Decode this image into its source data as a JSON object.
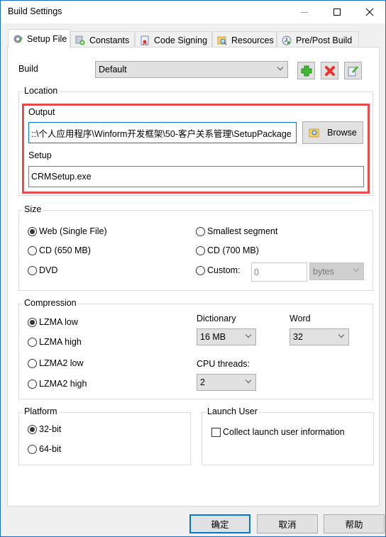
{
  "window": {
    "title": "Build Settings",
    "controls": [
      "minimize",
      "maximize",
      "close"
    ]
  },
  "tabs": [
    {
      "label": "Setup File",
      "icon": "gear-pencil-icon",
      "active": true
    },
    {
      "label": "Constants",
      "icon": "constants-add-icon",
      "active": false
    },
    {
      "label": "Code Signing",
      "icon": "certificate-icon",
      "active": false
    },
    {
      "label": "Resources",
      "icon": "resources-search-icon",
      "active": false
    },
    {
      "label": "Pre/Post Build",
      "icon": "clock-play-icon",
      "active": false
    }
  ],
  "build": {
    "label": "Build",
    "selected": "Default",
    "buttons": [
      {
        "name": "add",
        "icon": "plus-icon",
        "color": "#3fb832"
      },
      {
        "name": "delete",
        "icon": "x-icon",
        "color": "#e8322a"
      },
      {
        "name": "edit",
        "icon": "edit-icon",
        "color": "#3fb832"
      }
    ]
  },
  "location": {
    "title": "Location",
    "output_label": "Output",
    "output_value": "::\\个人应用程序\\Winform开发框架\\50-客户关系管理\\SetupPackage",
    "browse_label": "Browse",
    "setup_label": "Setup",
    "setup_value": "CRMSetup.exe",
    "highlight_color": "#e94b4b"
  },
  "size": {
    "title": "Size",
    "options": [
      {
        "label": "Web (Single File)",
        "checked": true
      },
      {
        "label": "CD (650 MB)",
        "checked": false
      },
      {
        "label": "DVD",
        "checked": false
      },
      {
        "label": "Smallest segment",
        "checked": false
      },
      {
        "label": "CD (700 MB)",
        "checked": false
      },
      {
        "label": "Custom:",
        "checked": false
      }
    ],
    "custom_value": "0",
    "custom_unit": "bytes"
  },
  "compression": {
    "title": "Compression",
    "options": [
      {
        "label": "LZMA low",
        "checked": true
      },
      {
        "label": "LZMA high",
        "checked": false
      },
      {
        "label": "LZMA2 low",
        "checked": false
      },
      {
        "label": "LZMA2 high",
        "checked": false
      }
    ],
    "dictionary_label": "Dictionary",
    "dictionary_value": "16 MB",
    "word_label": "Word",
    "word_value": "32",
    "cpu_label": "CPU threads:",
    "cpu_value": "2"
  },
  "platform": {
    "title": "Platform",
    "options": [
      {
        "label": "32-bit",
        "checked": true
      },
      {
        "label": "64-bit",
        "checked": false
      }
    ]
  },
  "launch_user": {
    "title": "Launch User",
    "checkbox_label": "Collect launch user information",
    "checked": false
  },
  "footer": {
    "ok": "确定",
    "cancel": "取消",
    "help": "帮助"
  }
}
